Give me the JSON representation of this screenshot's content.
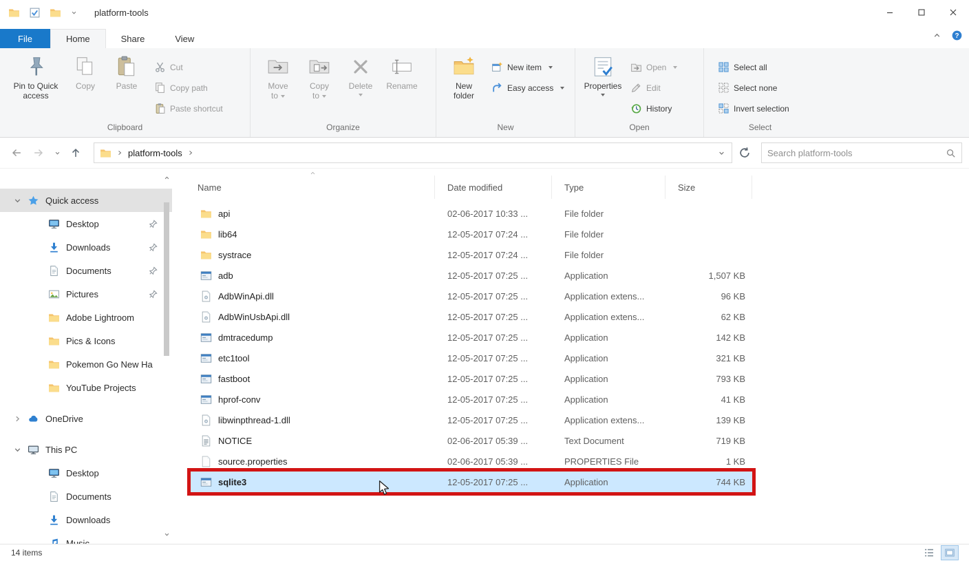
{
  "window": {
    "title": "platform-tools"
  },
  "menu_tabs": {
    "file": "File",
    "home": "Home",
    "share": "Share",
    "view": "View"
  },
  "ribbon": {
    "clipboard": {
      "label": "Clipboard",
      "pin": "Pin to Quick access",
      "copy": "Copy",
      "paste": "Paste",
      "cut": "Cut",
      "copy_path": "Copy path",
      "paste_shortcut": "Paste shortcut"
    },
    "organize": {
      "label": "Organize",
      "move_to": "Move to",
      "copy_to": "Copy to",
      "delete": "Delete",
      "rename": "Rename"
    },
    "new_group": {
      "label": "New",
      "new_folder": "New folder",
      "new_item": "New item",
      "easy_access": "Easy access"
    },
    "open_group": {
      "label": "Open",
      "properties": "Properties",
      "open": "Open",
      "edit": "Edit",
      "history": "History"
    },
    "select_group": {
      "label": "Select",
      "select_all": "Select all",
      "select_none": "Select none",
      "invert_selection": "Invert selection"
    }
  },
  "address_bar": {
    "path": "platform-tools",
    "search_placeholder": "Search platform-tools"
  },
  "sidebar": {
    "sections": [
      {
        "label": "Quick access",
        "icon": "star",
        "expanded": true,
        "selected": true,
        "children": [
          {
            "label": "Desktop",
            "icon": "desktop",
            "pinned": true
          },
          {
            "label": "Downloads",
            "icon": "download",
            "pinned": true
          },
          {
            "label": "Documents",
            "icon": "document",
            "pinned": true
          },
          {
            "label": "Pictures",
            "icon": "picture",
            "pinned": true
          },
          {
            "label": "Adobe Lightroom",
            "icon": "folder",
            "pinned": false
          },
          {
            "label": "Pics & Icons",
            "icon": "folder",
            "pinned": false
          },
          {
            "label": "Pokemon Go New Ha",
            "icon": "folder",
            "pinned": false
          },
          {
            "label": "YouTube Projects",
            "icon": "folder",
            "pinned": false
          }
        ]
      },
      {
        "label": "OneDrive",
        "icon": "onedrive",
        "expanded": false,
        "selected": false,
        "children": []
      },
      {
        "label": "This PC",
        "icon": "pc",
        "expanded": true,
        "selected": false,
        "children": [
          {
            "label": "Desktop",
            "icon": "desktop",
            "pinned": false
          },
          {
            "label": "Documents",
            "icon": "document",
            "pinned": false
          },
          {
            "label": "Downloads",
            "icon": "download",
            "pinned": false
          },
          {
            "label": "Music",
            "icon": "music",
            "pinned": false
          }
        ]
      }
    ]
  },
  "file_list": {
    "columns": {
      "name": "Name",
      "date": "Date modified",
      "type": "Type",
      "size": "Size"
    },
    "sort": {
      "column": "Name",
      "direction": "ascending"
    },
    "rows": [
      {
        "name": "api",
        "icon": "folder",
        "date": "02-06-2017 10:33 ...",
        "type": "File folder",
        "size": "",
        "selected": false
      },
      {
        "name": "lib64",
        "icon": "folder",
        "date": "12-05-2017 07:24 ...",
        "type": "File folder",
        "size": "",
        "selected": false
      },
      {
        "name": "systrace",
        "icon": "folder",
        "date": "12-05-2017 07:24 ...",
        "type": "File folder",
        "size": "",
        "selected": false
      },
      {
        "name": "adb",
        "icon": "app",
        "date": "12-05-2017 07:25 ...",
        "type": "Application",
        "size": "1,507 KB",
        "selected": false
      },
      {
        "name": "AdbWinApi.dll",
        "icon": "dll",
        "date": "12-05-2017 07:25 ...",
        "type": "Application extens...",
        "size": "96 KB",
        "selected": false
      },
      {
        "name": "AdbWinUsbApi.dll",
        "icon": "dll",
        "date": "12-05-2017 07:25 ...",
        "type": "Application extens...",
        "size": "62 KB",
        "selected": false
      },
      {
        "name": "dmtracedump",
        "icon": "app",
        "date": "12-05-2017 07:25 ...",
        "type": "Application",
        "size": "142 KB",
        "selected": false
      },
      {
        "name": "etc1tool",
        "icon": "app",
        "date": "12-05-2017 07:25 ...",
        "type": "Application",
        "size": "321 KB",
        "selected": false
      },
      {
        "name": "fastboot",
        "icon": "app",
        "date": "12-05-2017 07:25 ...",
        "type": "Application",
        "size": "793 KB",
        "selected": false
      },
      {
        "name": "hprof-conv",
        "icon": "app",
        "date": "12-05-2017 07:25 ...",
        "type": "Application",
        "size": "41 KB",
        "selected": false
      },
      {
        "name": "libwinpthread-1.dll",
        "icon": "dll",
        "date": "12-05-2017 07:25 ...",
        "type": "Application extens...",
        "size": "139 KB",
        "selected": false
      },
      {
        "name": "NOTICE",
        "icon": "textdoc",
        "date": "02-06-2017 05:39 ...",
        "type": "Text Document",
        "size": "719 KB",
        "selected": false
      },
      {
        "name": "source.properties",
        "icon": "propsfile",
        "date": "02-06-2017 05:39 ...",
        "type": "PROPERTIES File",
        "size": "1 KB",
        "selected": false
      },
      {
        "name": "sqlite3",
        "icon": "app",
        "date": "12-05-2017 07:25 ...",
        "type": "Application",
        "size": "744 KB",
        "selected": true,
        "annotated": true
      }
    ]
  },
  "status_bar": {
    "items_count": "14 items"
  },
  "colors": {
    "file_tab_blue": "#1979ca",
    "selection_blue": "#cce8ff",
    "annotation_red": "#d21414"
  }
}
